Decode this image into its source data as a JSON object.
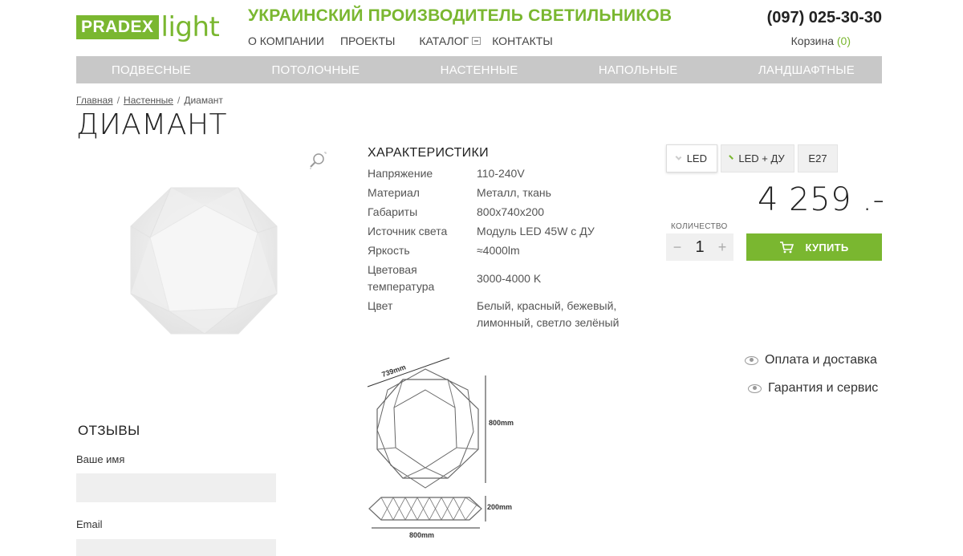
{
  "header": {
    "logo_primary": "PRADEX",
    "logo_secondary": "light",
    "tagline": "УКРАИНСКИЙ ПРОИЗВОДИТЕЛЬ СВЕТИЛЬНИКОВ",
    "nav": [
      "О КОМПАНИИ",
      "ПРОЕКТЫ",
      "КАТАЛОГ",
      "КОНТАКТЫ"
    ],
    "phone": "(097) 025-30-30",
    "cart_label": "Корзина",
    "cart_count": "(0)"
  },
  "categories": [
    "ПОДВЕСНЫЕ",
    "ПОТОЛОЧНЫЕ",
    "НАСТЕННЫЕ",
    "НАПОЛЬНЫЕ",
    "ЛАНДШАФТНЫЕ"
  ],
  "breadcrumb": {
    "items": [
      "Главная",
      "Настенные"
    ],
    "current": "Диамант"
  },
  "product": {
    "title": "ДИАМАНТ",
    "specs_title": "ХАРАКТЕРИСТИКИ",
    "specs": [
      {
        "key": "Напряжение",
        "value": "110-240V"
      },
      {
        "key": "Материал",
        "value": "Металл, ткань"
      },
      {
        "key": "Габариты",
        "value": "800x740x200"
      },
      {
        "key": "Источник света",
        "value": "Модуль LED 45W с ДУ"
      },
      {
        "key": "Яркость",
        "value": "≈4000lm"
      },
      {
        "key": "Цветовая температура",
        "value": "3000-4000 K"
      },
      {
        "key": "Цвет",
        "value": "Белый, красный, бежевый, лимонный, светло зелёный"
      }
    ],
    "drawing_labels": {
      "diag": "739mm",
      "height": "800mm",
      "depth": "200mm",
      "width": "800mm"
    },
    "options": [
      "LED",
      "LED + ДУ",
      "E27"
    ],
    "price": "4 259 .-",
    "qty_label": "КОЛИЧЕСТВО",
    "qty": "1",
    "qty_minus": "−",
    "qty_plus": "+",
    "buy_label": "КУПИТЬ",
    "links": [
      "Оплата и доставка",
      "Гарантия и сервис"
    ]
  },
  "reviews": {
    "title": "ОТЗЫВЫ",
    "name_label": "Ваше имя",
    "email_label": "Email"
  },
  "colors": {
    "accent": "#7ab730",
    "catbar": "#c8c8c8",
    "input_bg": "#efefef"
  }
}
